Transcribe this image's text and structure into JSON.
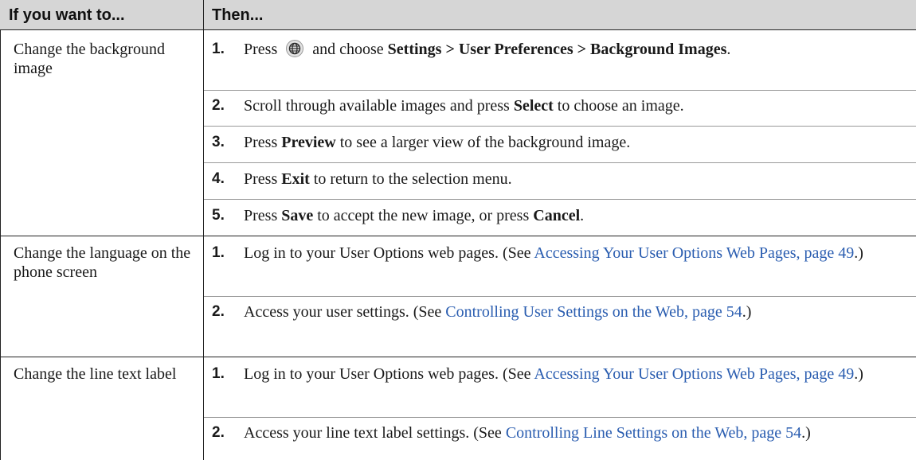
{
  "header": {
    "col1": "If you want to...",
    "col2": "Then..."
  },
  "rows": [
    {
      "task": "Change the background image",
      "steps": [
        {
          "n": "1.",
          "a": "Press",
          "b": "and choose",
          "c": "Settings > User Preferences > Background Images",
          "d": "."
        },
        {
          "n": "2.",
          "a": "Scroll through available images and press",
          "b": "Select",
          "c": "to choose an image."
        },
        {
          "n": "3.",
          "a": "Press",
          "b": "Preview",
          "c": "to see a larger view of the background image."
        },
        {
          "n": "4.",
          "a": "Press",
          "b": "Exit",
          "c": "to return to the selection menu."
        },
        {
          "n": "5.",
          "a": "Press",
          "b": "Save",
          "c": "to accept the new image, or press",
          "d": "Cancel",
          "e": "."
        }
      ]
    },
    {
      "task": "Change the language on the phone screen",
      "steps": [
        {
          "n": "1.",
          "a": "Log in to your User Options web pages. (See",
          "link": "Accessing Your User Options Web Pages, page 49",
          "e": ".)"
        },
        {
          "n": "2.",
          "a": "Access your user settings. (See",
          "link": "Controlling User Settings on the Web, page 54",
          "e": ".)"
        }
      ]
    },
    {
      "task": "Change the line text label",
      "steps": [
        {
          "n": "1.",
          "a": "Log in to your User Options web pages. (See",
          "link": "Accessing Your User Options Web Pages, page 49",
          "e": ".)"
        },
        {
          "n": "2.",
          "a": "Access your line text label settings. (See",
          "link": "Controlling Line Settings on the Web, page 54",
          "e": ".)"
        }
      ]
    }
  ],
  "icons": {
    "services_button": "globe-icon"
  }
}
